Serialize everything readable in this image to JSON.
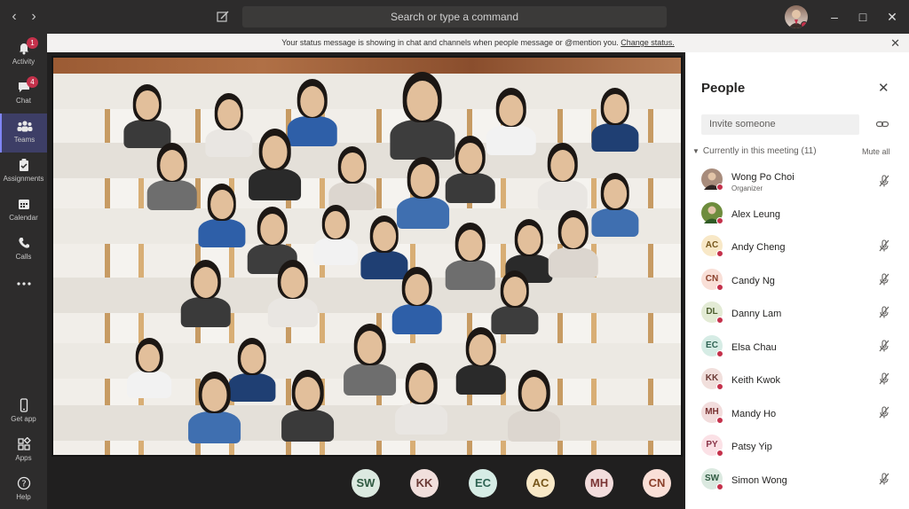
{
  "titlebar": {
    "search_placeholder": "Search or type a command",
    "back_icon": "chevron-left-icon",
    "forward_icon": "chevron-right-icon",
    "compose_icon": "compose-icon"
  },
  "rail": {
    "items": [
      {
        "label": "Activity",
        "icon": "bell-icon",
        "badge": "1"
      },
      {
        "label": "Chat",
        "icon": "chat-icon",
        "badge": "4"
      },
      {
        "label": "Teams",
        "icon": "teams-icon",
        "badge": ""
      },
      {
        "label": "Assignments",
        "icon": "assignments-icon",
        "badge": ""
      },
      {
        "label": "Calendar",
        "icon": "calendar-icon",
        "badge": ""
      },
      {
        "label": "Calls",
        "icon": "phone-icon",
        "badge": ""
      },
      {
        "label": "",
        "icon": "more-icon",
        "badge": ""
      },
      {
        "label": "Get app",
        "icon": "phone-device-icon",
        "badge": ""
      },
      {
        "label": "Apps",
        "icon": "apps-icon",
        "badge": ""
      },
      {
        "label": "Help",
        "icon": "help-icon",
        "badge": ""
      }
    ]
  },
  "banner": {
    "message": "Your status message is showing in chat and channels when people message or @mention you.",
    "link": "Change status."
  },
  "callbar": {
    "participants": [
      {
        "initials": "SW",
        "bg": "#dbe9e0",
        "fg": "#2f5a41"
      },
      {
        "initials": "KK",
        "bg": "#f1dfdc",
        "fg": "#6b3a35"
      },
      {
        "initials": "EC",
        "bg": "#d6ece5",
        "fg": "#2e6353"
      },
      {
        "initials": "AC",
        "bg": "#f8e8c7",
        "fg": "#76561b"
      },
      {
        "initials": "MH",
        "bg": "#f2dcdc",
        "fg": "#7a3434"
      },
      {
        "initials": "CN",
        "bg": "#f9dfd7",
        "fg": "#8a3f2a"
      }
    ]
  },
  "people": {
    "title": "People",
    "invite_placeholder": "Invite someone",
    "section_label": "Currently in this meeting (11)",
    "mute_all": "Mute all",
    "members": [
      {
        "name": "Wong Po Choi",
        "role": "Organizer",
        "initials": "",
        "bg": "#a88c7c",
        "fg": "#ffffff",
        "photo": true
      },
      {
        "name": "Alex Leung",
        "role": "",
        "initials": "",
        "bg": "#6e8c3d",
        "fg": "#ffffff",
        "photo": true
      },
      {
        "name": "Andy Cheng",
        "role": "",
        "initials": "AC",
        "bg": "#f8e8c7",
        "fg": "#76561b"
      },
      {
        "name": "Candy Ng",
        "role": "",
        "initials": "CN",
        "bg": "#f9dfd7",
        "fg": "#8a3f2a"
      },
      {
        "name": "Danny Lam",
        "role": "",
        "initials": "DL",
        "bg": "#e3ebd5",
        "fg": "#4d5e2f"
      },
      {
        "name": "Elsa Chau",
        "role": "",
        "initials": "EC",
        "bg": "#d6ece5",
        "fg": "#2e6353"
      },
      {
        "name": "Keith Kwok",
        "role": "",
        "initials": "KK",
        "bg": "#f1dfdc",
        "fg": "#6b3a35"
      },
      {
        "name": "Mandy Ho",
        "role": "",
        "initials": "MH",
        "bg": "#f2dcdc",
        "fg": "#7a3434"
      },
      {
        "name": "Patsy Yip",
        "role": "",
        "initials": "PY",
        "bg": "#fbe1e6",
        "fg": "#8a3448"
      },
      {
        "name": "Simon Wong",
        "role": "",
        "initials": "SW",
        "bg": "#dbe9e0",
        "fg": "#2f5a41"
      }
    ]
  }
}
